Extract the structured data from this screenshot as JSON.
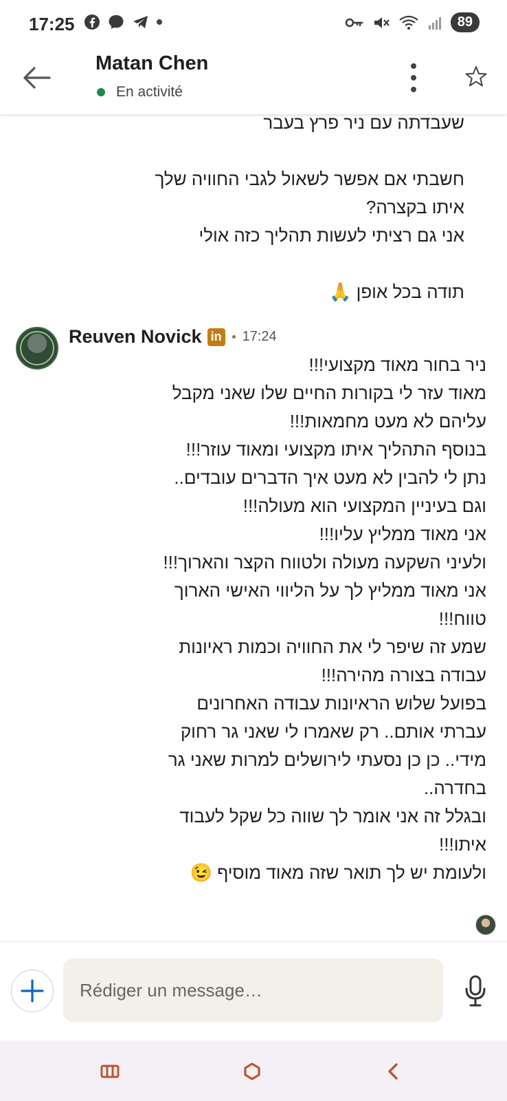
{
  "status_bar": {
    "time": "17:25",
    "battery": "89",
    "left_icons": [
      "facebook-icon",
      "messenger-icon",
      "telegram-icon"
    ],
    "right_icons": [
      "key-icon",
      "vibrate-icon",
      "wifi-icon",
      "signal-icon"
    ]
  },
  "header": {
    "contact_name": "Matan Chen",
    "status": "En activité",
    "status_color": "#1d8a4e"
  },
  "previous_message": {
    "lines": [
      "שעבדתה עם ניר פרץ בעבר",
      "",
      "חשבתי אם אפשר לשאול לגבי החוויה שלך",
      "איתו בקצרה?",
      "אני גם רציתי לעשות תהליך כזה אולי",
      "",
      "תודה בכל אופן 🙏"
    ]
  },
  "message": {
    "sender": "Reuven Novick",
    "badge": "in",
    "time": "17:24",
    "lines": [
      "ניר בחור מאוד מקצועי!!!",
      "מאוד עזר לי בקורות החיים שלו שאני מקבל",
      "עליהם לא מעט מחמאות!!!",
      "בנוסף התהליך איתו מקצועי ומאוד עוזר!!!",
      "נתן לי להבין לא מעט איך הדברים עובדים..",
      "וגם בעיניין המקצועי הוא מעולה!!!",
      "אני מאוד ממליץ עליו!!!",
      "ולעיני השקעה מעולה ולטווח הקצר והארוך!!!",
      "אני מאוד ממליץ לך על הליווי האישי הארוך",
      "טווח!!!",
      "שמע זה שיפר לי את החוויה וכמות ראיונות",
      "עבודה בצורה מהירה!!!",
      "בפועל שלוש הראיונות עבודה האחרונים",
      "עברתי אותם.. רק שאמרו לי שאני גר רחוק",
      "מידי.. כן כן נסעתי לירושלים למרות שאני גר",
      "בחדרה..",
      "ובגלל זה אני אומר לך שווה כל שקל לעבוד",
      "איתו!!!",
      "ולעומת יש לך תואר שזה מאוד מוסיף 😉"
    ]
  },
  "composer": {
    "placeholder": "Rédiger un message…",
    "accent": "#0a66c2"
  },
  "navbar": {
    "buttons": [
      "recent-apps",
      "home",
      "back"
    ],
    "accent": "#c0552d"
  }
}
